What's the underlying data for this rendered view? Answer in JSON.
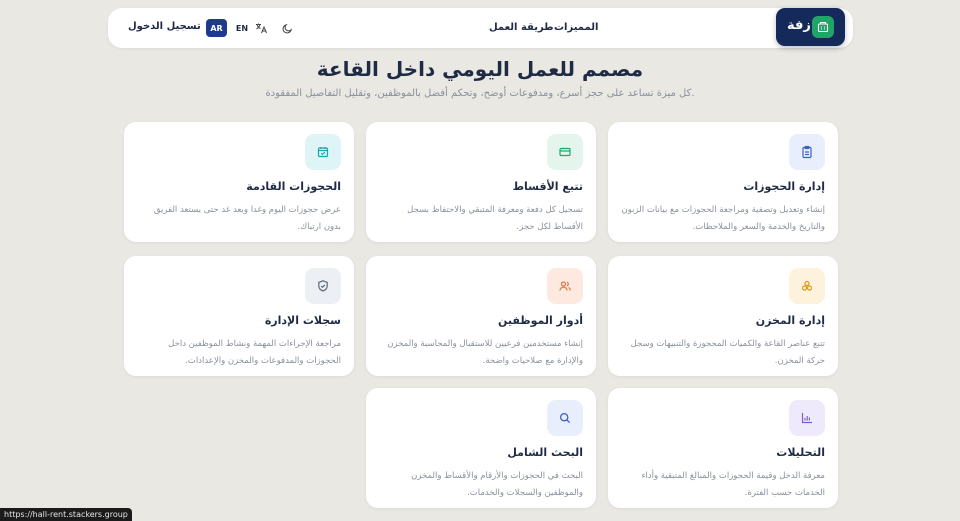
{
  "nav": {
    "login": "تسجيل الدخول",
    "lang_ar": "AR",
    "lang_en": "EN",
    "links": [
      "المميزات",
      "طريقة العمل"
    ],
    "brand": "زفة"
  },
  "hero": {
    "title": "مصمم للعمل اليومي داخل القاعة",
    "subtitle": "كل ميزة تساعد على حجز أسرع، ومدفوعات أوضح، وتحكم أفضل بالموظفين، وتقليل التفاصيل المفقودة."
  },
  "cards": [
    {
      "title": "إدارة الحجوزات",
      "desc": "إنشاء وتعديل وتصفية ومراجعة الحجوزات مع بيانات الزبون والتاريخ والخدمة والسعر والملاحظات.",
      "icon": "clipboard-icon",
      "icon_bg": "#e8eefb",
      "icon_color": "#3b63c4"
    },
    {
      "title": "تتبع الأقساط",
      "desc": "تسجيل كل دفعة ومعرفة المتبقي والاحتفاظ بسجل الأقساط لكل حجز.",
      "icon": "card-icon",
      "icon_bg": "#e3f5ec",
      "icon_color": "#22a468"
    },
    {
      "title": "الحجوزات القادمة",
      "desc": "عرض حجوزات اليوم وغدا وبعد غد حتى يستعد الفريق بدون ارتباك.",
      "icon": "calendar-icon",
      "icon_bg": "#dff4f6",
      "icon_color": "#1aa3b5"
    },
    {
      "title": "إدارة المخزن",
      "desc": "تتبع عناصر القاعة والكميات المحجوزة والتنبيهات وسجل حركة المخزن.",
      "icon": "boxes-icon",
      "icon_bg": "#fdf2dc",
      "icon_color": "#d99a1c"
    },
    {
      "title": "أدوار الموظفين",
      "desc": "إنشاء مستخدمين فرعيين للاستقبال والمحاسبة والمخزن والإدارة مع صلاحيات واضحة.",
      "icon": "users-icon",
      "icon_bg": "#fde9df",
      "icon_color": "#e0793e"
    },
    {
      "title": "سجلات الإدارة",
      "desc": "مراجعة الإجراءات المهمة ونشاط الموظفين داخل الحجوزات والمدفوعات والمخزن والإعدادات.",
      "icon": "shield-icon",
      "icon_bg": "#eceff3",
      "icon_color": "#5d6778"
    },
    {
      "title": "التحليلات",
      "desc": "معرفة الدخل وقيمة الحجوزات والمبالغ المتبقية وأداء الخدمات حسب الفترة.",
      "icon": "chart-icon",
      "icon_bg": "#efeafb",
      "icon_color": "#7b5cd6"
    },
    {
      "title": "البحث الشامل",
      "desc": "البحث في الحجوزات والأرقام والأقساط والمخزن والموظفين والسجلات والخدمات.",
      "icon": "search-icon",
      "icon_bg": "#e8eefb",
      "icon_color": "#3b63c4"
    }
  ],
  "status_url": "https://hall-rent.stackers.group"
}
